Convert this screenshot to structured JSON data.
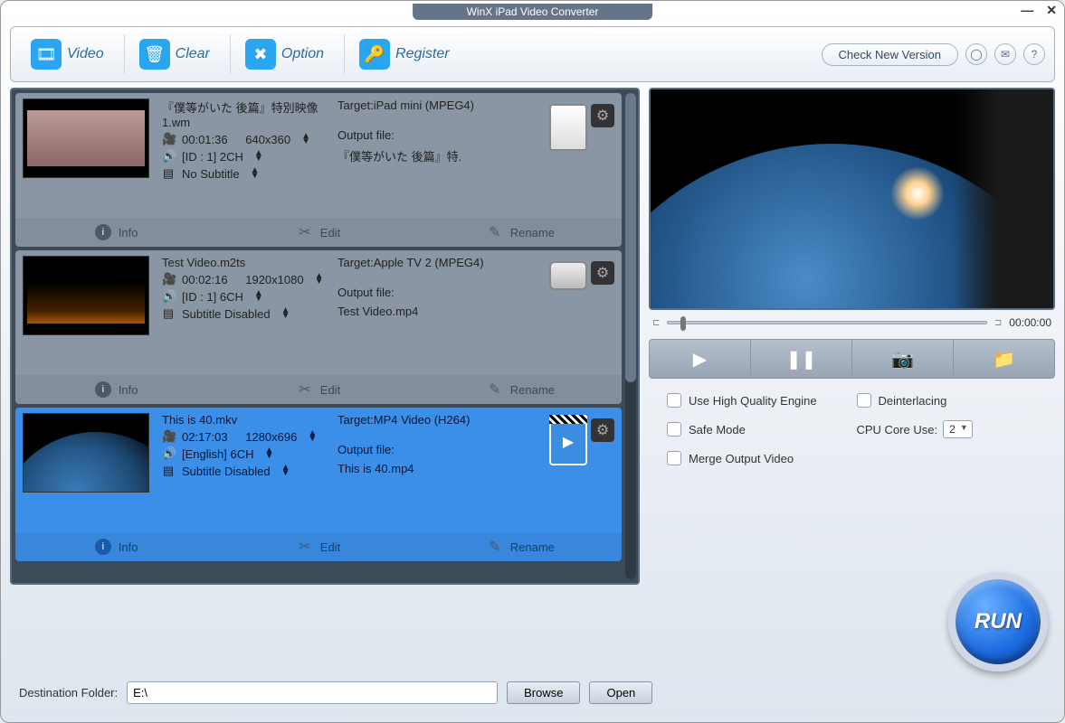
{
  "title": "WinX iPad Video Converter",
  "toolbar": {
    "video": "Video",
    "clear": "Clear",
    "option": "Option",
    "register": "Register",
    "check_version": "Check New Version"
  },
  "items": [
    {
      "filename": "『僕等がいた 後篇』特別映像1.wm",
      "duration": "00:01:36",
      "resolution": "640x360",
      "audio": "[ID : 1] 2CH",
      "subtitle": "No Subtitle",
      "target": "Target:iPad mini (MPEG4)",
      "output_label": "Output file:",
      "output_file": "『僕等がいた 後篇』特."
    },
    {
      "filename": "Test Video.m2ts",
      "duration": "00:02:16",
      "resolution": "1920x1080",
      "audio": "[ID : 1] 6CH",
      "subtitle": "Subtitle Disabled",
      "target": "Target:Apple TV 2 (MPEG4)",
      "output_label": "Output file:",
      "output_file": "Test Video.mp4"
    },
    {
      "filename": "This is 40.mkv",
      "duration": "02:17:03",
      "resolution": "1280x696",
      "audio": "[English] 6CH",
      "subtitle": "Subtitle Disabled",
      "target": "Target:MP4 Video (H264)",
      "output_label": "Output file:",
      "output_file": "This is 40.mp4"
    }
  ],
  "actions": {
    "info": "Info",
    "edit": "Edit",
    "rename": "Rename"
  },
  "preview": {
    "time": "00:00:00"
  },
  "options": {
    "hq": "Use High Quality Engine",
    "deint": "Deinterlacing",
    "safe": "Safe Mode",
    "cpu_label": "CPU Core Use:",
    "cpu_value": "2",
    "merge": "Merge Output Video"
  },
  "run": "RUN",
  "footer": {
    "dest_label": "Destination Folder:",
    "dest_value": "E:\\",
    "browse": "Browse",
    "open": "Open"
  }
}
